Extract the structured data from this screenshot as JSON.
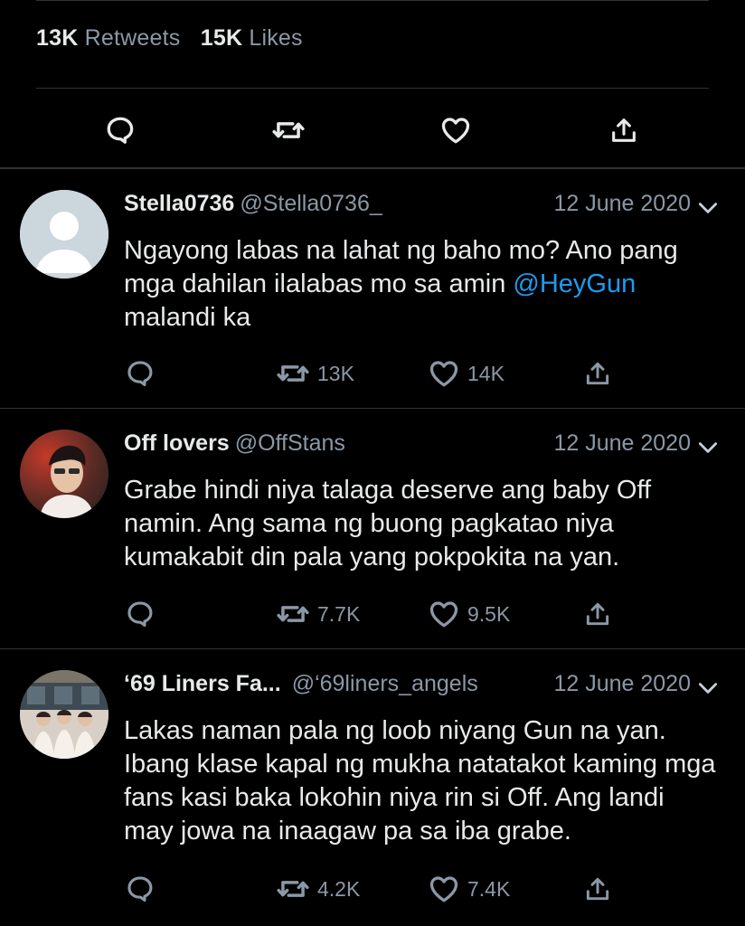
{
  "stats": {
    "retweets_count": "13K",
    "retweets_label": "Retweets",
    "likes_count": "15K",
    "likes_label": "Likes"
  },
  "replies": [
    {
      "name": "Stella0736",
      "handle": "@Stella0736_",
      "date": "12 June 2020",
      "text_before": "Ngayong labas na lahat ng baho mo? Ano pang mga dahilan ilalabas mo sa amin ",
      "mention": "@HeyGun",
      "text_after": " malandi ka",
      "retweets": "13K",
      "likes": "14K"
    },
    {
      "name": "Off lovers",
      "handle": "@OffStans",
      "date": "12 June 2020",
      "text": "Grabe hindi niya talaga deserve ang baby Off namin. Ang sama ng buong pagkatao niya kumakabit din pala yang pokpokita na yan.",
      "retweets": "7.7K",
      "likes": "9.5K"
    },
    {
      "name": "‘69 Liners Fa...",
      "handle": "@‘69liners_angels",
      "date": "12 June 2020",
      "text": "Lakas naman pala ng loob niyang Gun na yan. Ibang klase kapal ng mukha natatakot kaming mga fans kasi baka lokohin niya rin si Off. Ang landi may jowa na inaagaw pa sa iba grabe.",
      "retweets": "4.2K",
      "likes": "7.4K"
    }
  ],
  "icons": {
    "reply": "reply-icon",
    "retweet": "retweet-icon",
    "like": "heart-icon",
    "share": "share-icon",
    "caret": "chevron-down-icon"
  },
  "colors": {
    "background": "#000000",
    "text": "#e7e9ea",
    "muted": "#8b98a5",
    "link": "#1d9bf0",
    "divider": "#2f3336"
  }
}
